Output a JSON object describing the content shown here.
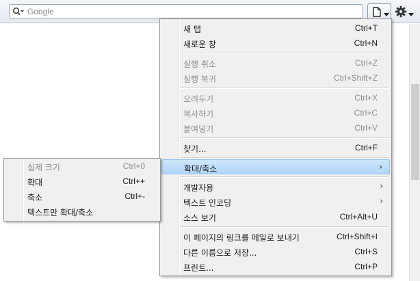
{
  "toolbar": {
    "search": {
      "placeholder": "Google",
      "engine_icon": "search-glass-icon"
    },
    "page_button_icon": "page-icon",
    "tools_button_icon": "gear-icon"
  },
  "main_menu": {
    "items": [
      {
        "label": "새 탭",
        "shortcut": "Ctrl+T",
        "enabled": true
      },
      {
        "label": "새로운 창",
        "shortcut": "Ctrl+N",
        "enabled": true
      },
      {
        "label": "실행 취소",
        "shortcut": "Ctrl+Z",
        "enabled": false
      },
      {
        "label": "실행 복귀",
        "shortcut": "Ctrl+Shift+Z",
        "enabled": false
      },
      {
        "label": "오려두기",
        "shortcut": "Ctrl+X",
        "enabled": false
      },
      {
        "label": "복사하기",
        "shortcut": "Ctrl+C",
        "enabled": false
      },
      {
        "label": "붙여넣기",
        "shortcut": "Ctrl+V",
        "enabled": false
      },
      {
        "label": "찾기...",
        "shortcut": "Ctrl+F",
        "enabled": true
      },
      {
        "label": "확대/축소",
        "submenu": true,
        "highlighted": true,
        "enabled": true
      },
      {
        "label": "개발자용",
        "submenu": true,
        "enabled": true
      },
      {
        "label": "텍스트 인코딩",
        "submenu": true,
        "enabled": true
      },
      {
        "label": "소스 보기",
        "shortcut": "Ctrl+Alt+U",
        "enabled": true
      },
      {
        "label": "이 페이지의 링크를 메일로 보내기",
        "shortcut": "Ctrl+Shift+I",
        "enabled": true
      },
      {
        "label": "다른 이름으로 저장...",
        "shortcut": "Ctrl+S",
        "enabled": true
      },
      {
        "label": "프린트...",
        "shortcut": "Ctrl+P",
        "enabled": true
      }
    ],
    "submenu_arrow": "›"
  },
  "zoom_submenu": {
    "items": [
      {
        "label": "실제 크기",
        "shortcut": "Ctrl+0",
        "enabled": false
      },
      {
        "label": "확대",
        "shortcut": "Ctrl++",
        "enabled": true
      },
      {
        "label": "축소",
        "shortcut": "Ctrl+-",
        "enabled": true
      },
      {
        "label": "텍스트만 확대/축소",
        "enabled": true
      }
    ]
  },
  "colors": {
    "highlight": "#b2d5f7",
    "menu_bg": "#f0f0f0",
    "disabled_text": "#8d8d8d"
  }
}
